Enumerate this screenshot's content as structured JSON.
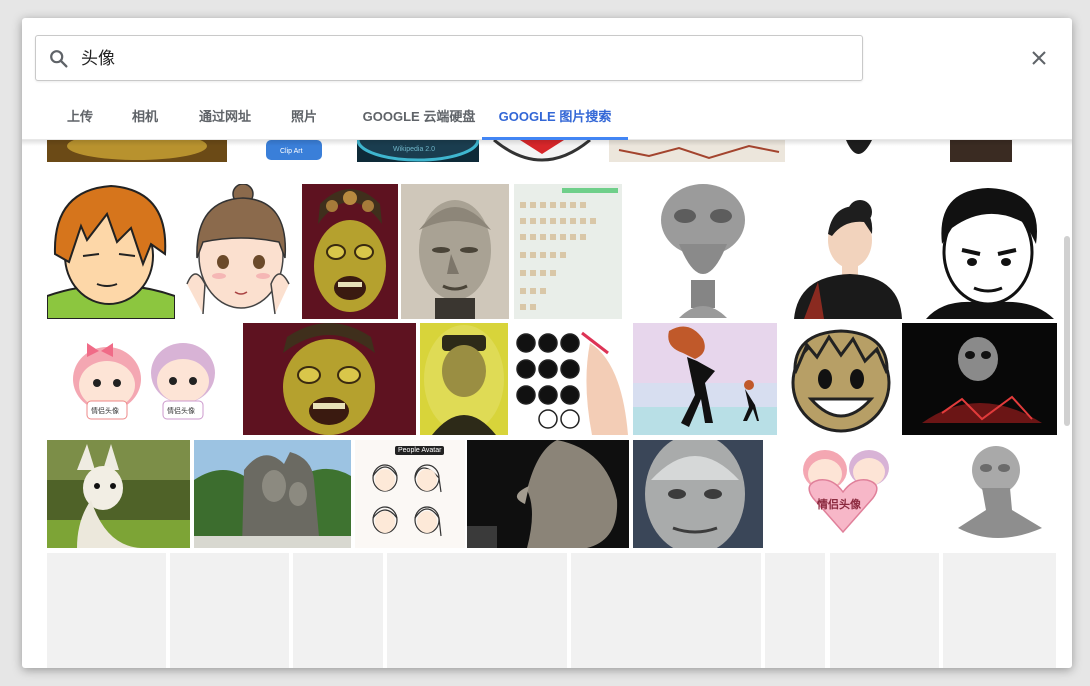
{
  "search": {
    "value": "头像"
  },
  "tabs": [
    {
      "label": "上传"
    },
    {
      "label": "相机"
    },
    {
      "label": "通过网址"
    },
    {
      "label": "照片"
    },
    {
      "label": "GOOGLE 云端硬盘"
    },
    {
      "label": "GOOGLE 图片搜索"
    }
  ],
  "active_tab": "GOOGLE 图片搜索",
  "colors": {
    "accent": "#4285f4",
    "active_text": "#3367d6",
    "tab_text": "#5f6368"
  },
  "image_labels": {
    "couple_caption_a": "情侣头像",
    "couple_caption_b": "情侣头像",
    "couple_heart_text": "情侣头像",
    "people_avatar": "People Avatar",
    "clip_art": "Clip Art",
    "wiki_fragment": "Wikipedia 2.0"
  }
}
